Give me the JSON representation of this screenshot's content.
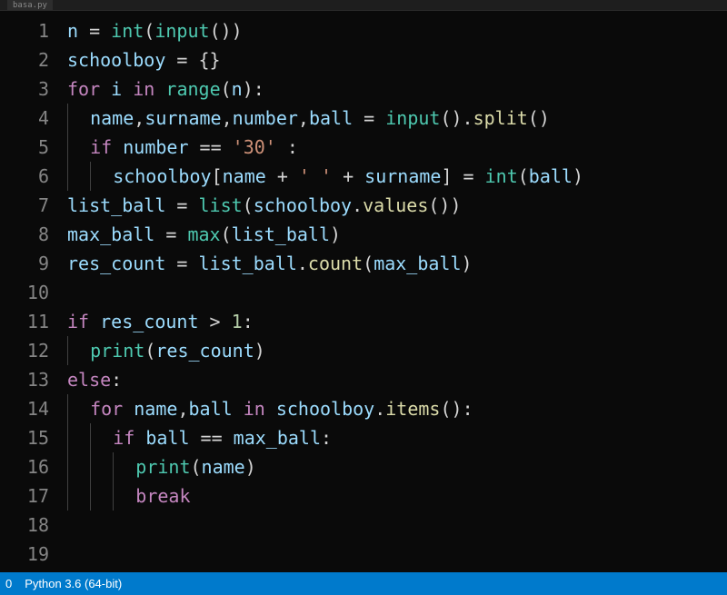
{
  "tab": {
    "label": "basa.py"
  },
  "statusbar": {
    "errors": "0",
    "language": "Python 3.6 (64-bit)"
  },
  "lines": [
    {
      "n": "1",
      "tokens": [
        [
          "var",
          "n"
        ],
        [
          "op",
          " = "
        ],
        [
          "func-sp",
          "int"
        ],
        [
          "punct",
          "("
        ],
        [
          "func-sp",
          "input"
        ],
        [
          "punct",
          "())"
        ]
      ]
    },
    {
      "n": "2",
      "tokens": [
        [
          "var",
          "schoolboy"
        ],
        [
          "op",
          " = "
        ],
        [
          "punct",
          "{}"
        ]
      ]
    },
    {
      "n": "3",
      "tokens": [
        [
          "kw",
          "for"
        ],
        [
          "op",
          " "
        ],
        [
          "var",
          "i"
        ],
        [
          "op",
          " "
        ],
        [
          "kw",
          "in"
        ],
        [
          "op",
          " "
        ],
        [
          "func-sp",
          "range"
        ],
        [
          "punct",
          "("
        ],
        [
          "var",
          "n"
        ],
        [
          "punct",
          "):"
        ]
      ]
    },
    {
      "n": "4",
      "indent": 1,
      "tokens": [
        [
          "var",
          "name"
        ],
        [
          "punct",
          ","
        ],
        [
          "var",
          "surname"
        ],
        [
          "punct",
          ","
        ],
        [
          "var",
          "number"
        ],
        [
          "punct",
          ","
        ],
        [
          "var",
          "ball"
        ],
        [
          "op",
          " = "
        ],
        [
          "func-sp",
          "input"
        ],
        [
          "punct",
          "()."
        ],
        [
          "func",
          "split"
        ],
        [
          "punct",
          "()"
        ]
      ]
    },
    {
      "n": "5",
      "indent": 1,
      "tokens": [
        [
          "kw",
          "if"
        ],
        [
          "op",
          " "
        ],
        [
          "var",
          "number"
        ],
        [
          "op",
          " == "
        ],
        [
          "str",
          "'30'"
        ],
        [
          "op",
          " "
        ],
        [
          "punct",
          ":"
        ]
      ]
    },
    {
      "n": "6",
      "indent": 2,
      "tokens": [
        [
          "var",
          "schoolboy"
        ],
        [
          "punct",
          "["
        ],
        [
          "var",
          "name"
        ],
        [
          "op",
          " + "
        ],
        [
          "str",
          "' '"
        ],
        [
          "op",
          " + "
        ],
        [
          "var",
          "surname"
        ],
        [
          "punct",
          "]"
        ],
        [
          "op",
          " = "
        ],
        [
          "func-sp",
          "int"
        ],
        [
          "punct",
          "("
        ],
        [
          "var",
          "ball"
        ],
        [
          "punct",
          ")"
        ]
      ]
    },
    {
      "n": "7",
      "tokens": [
        [
          "var",
          "list_ball"
        ],
        [
          "op",
          " = "
        ],
        [
          "func-sp",
          "list"
        ],
        [
          "punct",
          "("
        ],
        [
          "var",
          "schoolboy"
        ],
        [
          "punct",
          "."
        ],
        [
          "func",
          "values"
        ],
        [
          "punct",
          "())"
        ]
      ]
    },
    {
      "n": "8",
      "tokens": [
        [
          "var",
          "max_ball"
        ],
        [
          "op",
          " = "
        ],
        [
          "func-sp",
          "max"
        ],
        [
          "punct",
          "("
        ],
        [
          "var",
          "list_ball"
        ],
        [
          "punct",
          ")"
        ]
      ]
    },
    {
      "n": "9",
      "tokens": [
        [
          "var",
          "res_count"
        ],
        [
          "op",
          " = "
        ],
        [
          "var",
          "list_ball"
        ],
        [
          "punct",
          "."
        ],
        [
          "func",
          "count"
        ],
        [
          "punct",
          "("
        ],
        [
          "var",
          "max_ball"
        ],
        [
          "punct",
          ")"
        ]
      ]
    },
    {
      "n": "10",
      "tokens": []
    },
    {
      "n": "11",
      "tokens": [
        [
          "kw",
          "if"
        ],
        [
          "op",
          " "
        ],
        [
          "var",
          "res_count"
        ],
        [
          "op",
          " > "
        ],
        [
          "num",
          "1"
        ],
        [
          "punct",
          ":"
        ]
      ]
    },
    {
      "n": "12",
      "indent": 1,
      "tokens": [
        [
          "func-sp",
          "print"
        ],
        [
          "punct",
          "("
        ],
        [
          "var",
          "res_count"
        ],
        [
          "punct",
          ")"
        ]
      ]
    },
    {
      "n": "13",
      "tokens": [
        [
          "kw",
          "else"
        ],
        [
          "punct",
          ":"
        ]
      ]
    },
    {
      "n": "14",
      "indent": 1,
      "tokens": [
        [
          "kw",
          "for"
        ],
        [
          "op",
          " "
        ],
        [
          "var",
          "name"
        ],
        [
          "punct",
          ","
        ],
        [
          "var",
          "ball"
        ],
        [
          "op",
          " "
        ],
        [
          "kw",
          "in"
        ],
        [
          "op",
          " "
        ],
        [
          "var",
          "schoolboy"
        ],
        [
          "punct",
          "."
        ],
        [
          "func",
          "items"
        ],
        [
          "punct",
          "():"
        ]
      ]
    },
    {
      "n": "15",
      "indent": 2,
      "tokens": [
        [
          "kw",
          "if"
        ],
        [
          "op",
          " "
        ],
        [
          "var",
          "ball"
        ],
        [
          "op",
          " == "
        ],
        [
          "var",
          "max_ball"
        ],
        [
          "punct",
          ":"
        ]
      ]
    },
    {
      "n": "16",
      "indent": 3,
      "tokens": [
        [
          "func-sp",
          "print"
        ],
        [
          "punct",
          "("
        ],
        [
          "var",
          "name"
        ],
        [
          "punct",
          ")"
        ]
      ]
    },
    {
      "n": "17",
      "indent": 3,
      "tokens": [
        [
          "kw",
          "break"
        ]
      ]
    },
    {
      "n": "18",
      "tokens": []
    },
    {
      "n": "19",
      "tokens": []
    }
  ]
}
